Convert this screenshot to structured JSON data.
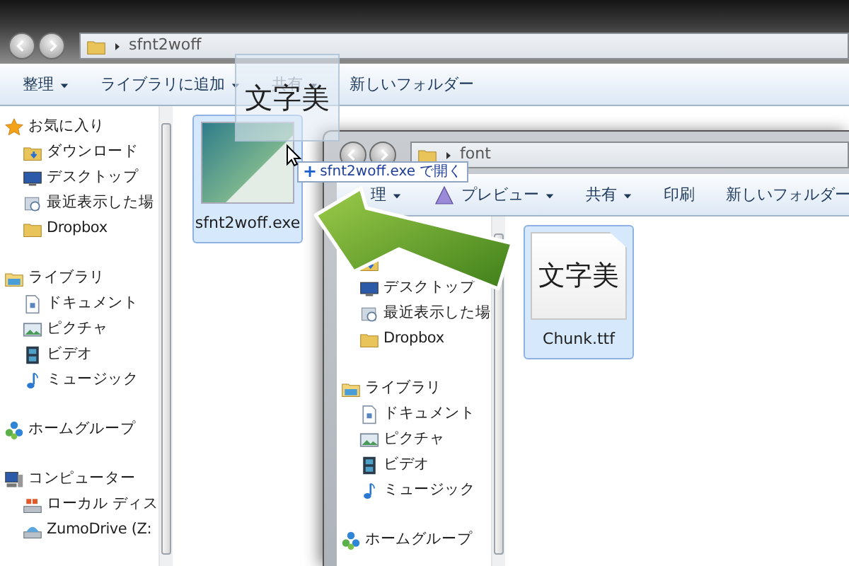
{
  "back_window": {
    "address": {
      "path": "sfnt2woff"
    },
    "toolbar": [
      {
        "label": "整理",
        "has_menu": true,
        "disabled": false
      },
      {
        "label": "ライブラリに追加",
        "has_menu": true,
        "disabled": false
      },
      {
        "label": "共有",
        "has_menu": true,
        "disabled": true
      },
      {
        "label": "新しいフォルダー",
        "has_menu": false,
        "disabled": false
      }
    ],
    "sidebar": [
      {
        "label": "お気に入り",
        "kind": "favorites",
        "children": [
          {
            "label": "ダウンロード",
            "kind": "downloads"
          },
          {
            "label": "デスクトップ",
            "kind": "desktop"
          },
          {
            "label": "最近表示した場",
            "kind": "recent"
          },
          {
            "label": "Dropbox",
            "kind": "folder"
          }
        ]
      },
      {
        "label": "ライブラリ",
        "kind": "library",
        "children": [
          {
            "label": "ドキュメント",
            "kind": "documents"
          },
          {
            "label": "ピクチャ",
            "kind": "pictures"
          },
          {
            "label": "ビデオ",
            "kind": "videos"
          },
          {
            "label": "ミュージック",
            "kind": "music"
          }
        ]
      },
      {
        "label": "ホームグループ",
        "kind": "homegroup"
      },
      {
        "label": "コンピューター",
        "kind": "computer",
        "children": [
          {
            "label": "ローカル ディス",
            "kind": "drive"
          },
          {
            "label": "ZumoDrive (Z:",
            "kind": "netdrive"
          }
        ]
      }
    ],
    "files": [
      {
        "name": "sfnt2woff.exe",
        "kind": "app",
        "selected": true
      }
    ]
  },
  "front_window": {
    "address": {
      "path": "font"
    },
    "toolbar": [
      {
        "label": "理",
        "has_menu": true,
        "disabled": false
      },
      {
        "label": "プレビュー",
        "kind": "preview",
        "has_menu": true,
        "disabled": false
      },
      {
        "label": "共有",
        "has_menu": true,
        "disabled": false
      },
      {
        "label": "印刷",
        "has_menu": false,
        "disabled": false
      },
      {
        "label": "新しいフォルダー",
        "has_menu": false,
        "disabled": false
      }
    ],
    "sidebar": [
      {
        "kind": "hidden",
        "children": [
          {
            "kind": "downloads"
          },
          {
            "label": "デスクトップ",
            "kind": "desktop"
          },
          {
            "label": "最近表示した場",
            "kind": "recent"
          },
          {
            "label": "Dropbox",
            "kind": "folder"
          }
        ]
      },
      {
        "label": "ライブラリ",
        "kind": "library",
        "children": [
          {
            "label": "ドキュメント",
            "kind": "documents"
          },
          {
            "label": "ピクチャ",
            "kind": "pictures"
          },
          {
            "label": "ビデオ",
            "kind": "videos"
          },
          {
            "label": "ミュージック",
            "kind": "music"
          }
        ]
      },
      {
        "label": "ホームグループ",
        "kind": "homegroup"
      }
    ],
    "files": [
      {
        "name": "Chunk.ttf",
        "kind": "font",
        "preview": "文字美",
        "selected": true
      }
    ]
  },
  "drag": {
    "preview": "文字美",
    "tooltip": {
      "symbol": "+",
      "text": "sfnt2woff.exe で開く"
    }
  }
}
